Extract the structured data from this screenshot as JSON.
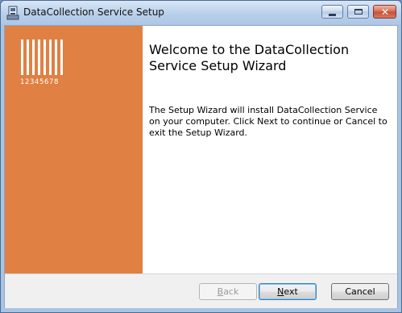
{
  "window": {
    "title": "DataCollection Service Setup"
  },
  "icons": {
    "app": "installer-icon",
    "minimize": "minimize-icon",
    "maximize": "maximize-icon",
    "close": "close-icon"
  },
  "sidebar": {
    "logo_text": "12345678",
    "background_color": "#e08042"
  },
  "main": {
    "heading": "Welcome to the DataCollection Service Setup Wizard",
    "description": "The Setup Wizard will install DataCollection Service on your computer. Click Next to continue or Cancel to exit the Setup Wizard."
  },
  "buttons": {
    "back": {
      "prefix": "",
      "accel": "B",
      "suffix": "ack",
      "enabled": false
    },
    "next": {
      "prefix": "",
      "accel": "N",
      "suffix": "ext",
      "enabled": true
    },
    "cancel": {
      "label": "Cancel",
      "enabled": true
    }
  }
}
